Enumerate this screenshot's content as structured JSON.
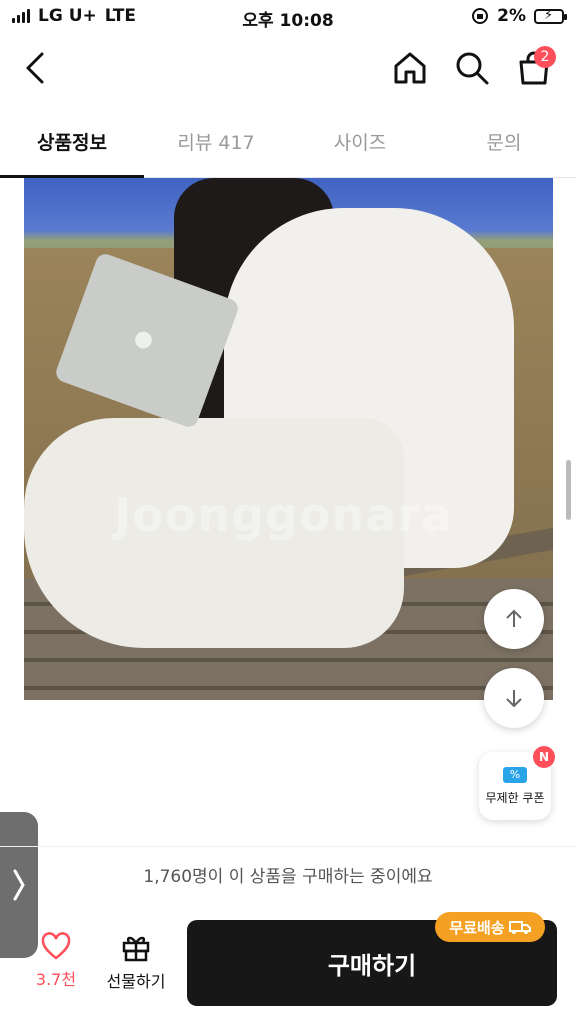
{
  "status_bar": {
    "carrier": "LG U+",
    "network": "LTE",
    "time": "오후 10:08",
    "battery": "2%"
  },
  "header": {
    "cart_count": "2"
  },
  "tabs": [
    {
      "label": "상품정보"
    },
    {
      "label": "리뷰 417"
    },
    {
      "label": "사이즈"
    },
    {
      "label": "문의"
    }
  ],
  "product": {
    "watermark": "Joonggonara"
  },
  "coupon": {
    "label": "무제한 쿠폰",
    "badge": "N"
  },
  "buyers_text": "1,760명이 이 상품을 구매하는 중이에요",
  "bottom_bar": {
    "like_count": "3.7천",
    "gift_label": "선물하기",
    "buy_label": "구매하기",
    "free_shipping": "무료배송"
  },
  "colors": {
    "accent": "#ff4f5b",
    "buy_button": "#171717",
    "free_shipping": "#f4a022"
  }
}
